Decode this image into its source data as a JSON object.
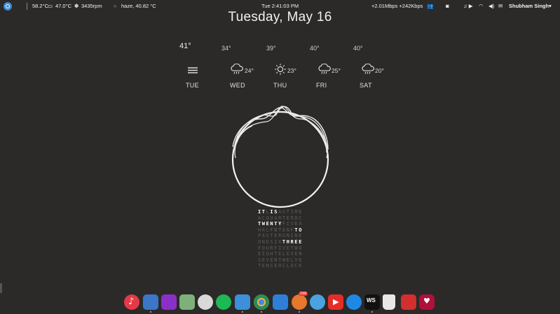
{
  "panel": {
    "system_stats": "58.2°C",
    "gpu_temp": "47.0°C",
    "fan": "3435rpm",
    "weather": "haze, 40.82 °C",
    "clock": "Tue  2:41:03 PM",
    "network": "+2.01Mbps +242Kbps",
    "user": "Shubham Singh"
  },
  "date": "Tuesday, May 16",
  "forecast": [
    {
      "high": "41°",
      "low": "",
      "day": "TUE",
      "icon": "haze-icon"
    },
    {
      "high": "34°",
      "low": "24°",
      "day": "WED",
      "icon": "cloud-rain-icon"
    },
    {
      "high": "39°",
      "low": "23°",
      "day": "THU",
      "icon": "sun-icon"
    },
    {
      "high": "40°",
      "low": "25°",
      "day": "FRI",
      "icon": "cloud-rain-icon"
    },
    {
      "high": "40°",
      "low": "20°",
      "day": "SAT",
      "icon": "cloud-rain-icon"
    }
  ],
  "word_clock": [
    {
      "text": "ITLISASTIME",
      "on": [
        [
          0,
          2
        ],
        [
          3,
          5
        ]
      ]
    },
    {
      "text": "ACQUARTERDC",
      "on": []
    },
    {
      "text": "TWENTYFIVEX",
      "on": [
        [
          0,
          6
        ]
      ]
    },
    {
      "text": "HALFBTENFTO",
      "on": [
        [
          9,
          11
        ]
      ]
    },
    {
      "text": "PASTERUNINE",
      "on": []
    },
    {
      "text": "ONESIXTHREE",
      "on": [
        [
          6,
          11
        ]
      ]
    },
    {
      "text": "FOURFIVETWO",
      "on": []
    },
    {
      "text": "EIGHTELEVEN",
      "on": []
    },
    {
      "text": "SEVENTWELVE",
      "on": []
    },
    {
      "text": "TENSEOCLOCK",
      "on": []
    }
  ],
  "dock": {
    "badge": "298",
    "apps": [
      "music",
      "mail",
      "video-editor",
      "notes",
      "browser-disc",
      "spotify",
      "finder",
      "chrome",
      "files",
      "feed",
      "tweetbot",
      "youtube",
      "shazam",
      "webstorm",
      "trash",
      "pdf",
      "app"
    ]
  },
  "colors": {
    "background": "#2b2a29",
    "text": "#f0f0f0",
    "dim": "#5c5c5a"
  }
}
